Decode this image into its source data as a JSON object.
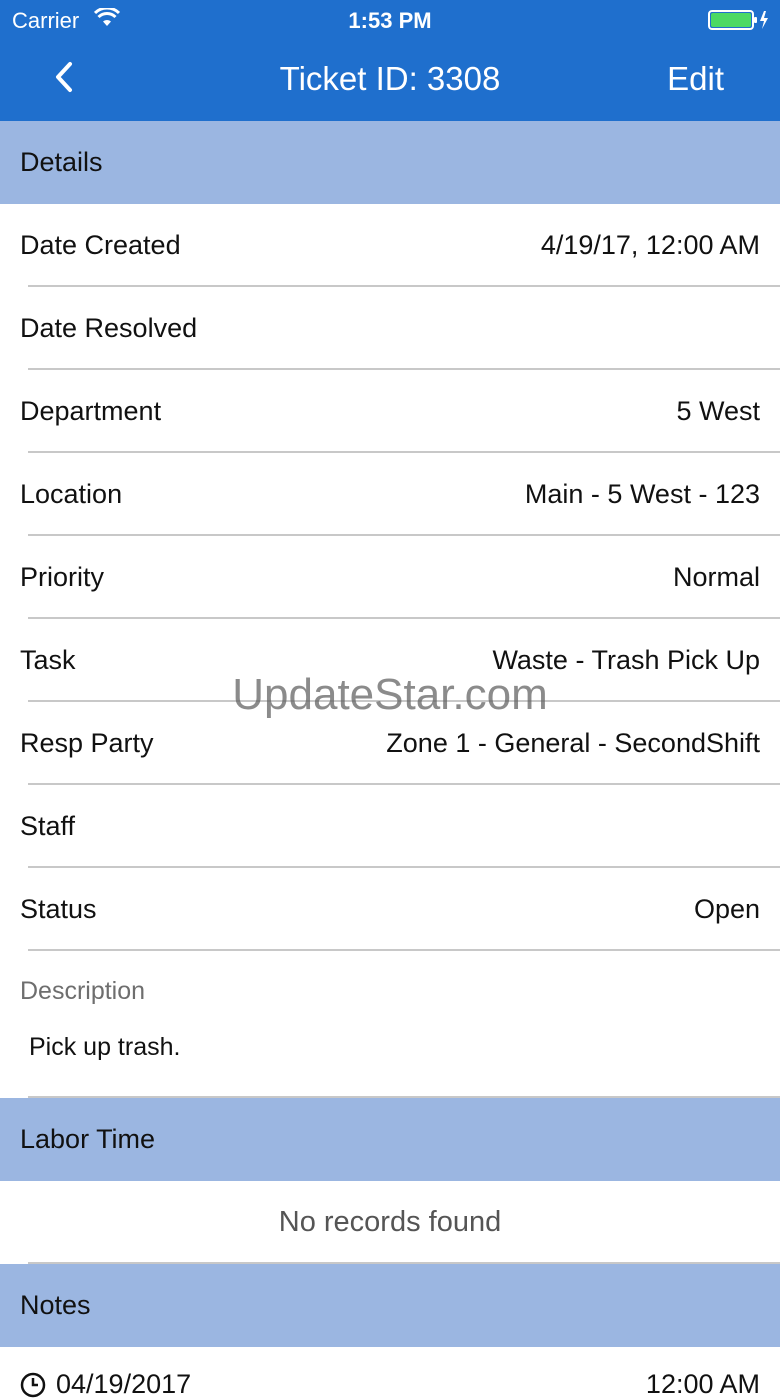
{
  "status_bar": {
    "carrier": "Carrier",
    "time": "1:53 PM",
    "battery_color": "#4cd964"
  },
  "nav": {
    "title": "Ticket ID: 3308",
    "edit_label": "Edit",
    "back_icon": "chevron-left-icon",
    "bar_color": "#1f6fcd"
  },
  "details": {
    "header": "Details",
    "rows": [
      {
        "label": "Date Created",
        "value": "4/19/17, 12:00 AM"
      },
      {
        "label": "Date Resolved",
        "value": ""
      },
      {
        "label": "Department",
        "value": "5 West"
      },
      {
        "label": "Location",
        "value": "Main - 5 West - 123"
      },
      {
        "label": "Priority",
        "value": "Normal"
      },
      {
        "label": "Task",
        "value": "Waste - Trash Pick Up"
      },
      {
        "label": "Resp Party",
        "value": "Zone 1 - General - SecondShift"
      },
      {
        "label": "Staff",
        "value": ""
      },
      {
        "label": "Status",
        "value": "Open"
      }
    ],
    "description_label": "Description",
    "description_text": "Pick up trash."
  },
  "labor_time": {
    "header": "Labor Time",
    "empty_text": "No records found"
  },
  "notes": {
    "header": "Notes",
    "items": [
      {
        "date": "04/19/2017",
        "time": "12:00 AM",
        "icon": "clock-icon"
      }
    ]
  },
  "watermark": "UpdateStar.com",
  "colors": {
    "section_header_bg": "#9bb6e1",
    "separator": "#c8c8c8"
  }
}
